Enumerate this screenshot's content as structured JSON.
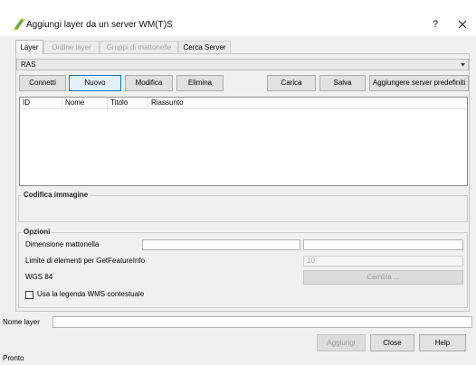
{
  "window": {
    "title": "Aggiungi layer da un server WM(T)S",
    "help_button": "?",
    "app_icon": "qgis-icon",
    "close_icon": "close-icon"
  },
  "tabs": [
    {
      "label": "Layer",
      "active": true,
      "enabled": true
    },
    {
      "label": "Ordine layer",
      "active": false,
      "enabled": false
    },
    {
      "label": "Gruppi di mattonelle",
      "active": false,
      "enabled": false
    },
    {
      "label": "Cerca Server",
      "active": false,
      "enabled": true
    }
  ],
  "connection": {
    "selected": "RAS",
    "dropdown_icon": "chevron-down-icon"
  },
  "connection_buttons": [
    {
      "label": "Connetti",
      "enabled": true,
      "focused": false
    },
    {
      "label": "Nuovo",
      "enabled": true,
      "focused": true
    },
    {
      "label": "Modifica",
      "enabled": true,
      "focused": false
    },
    {
      "label": "Elimina",
      "enabled": true,
      "focused": false
    },
    {
      "label": "Carica",
      "enabled": true,
      "focused": false
    },
    {
      "label": "Salva",
      "enabled": true,
      "focused": false
    },
    {
      "label": "Aggiungere server predefiniti",
      "enabled": true,
      "focused": false
    }
  ],
  "layers_table": {
    "columns": [
      "ID",
      "Nome",
      "Titolo",
      "Riassunto"
    ],
    "rows": []
  },
  "image_encoding": {
    "title": "Codifica immagine",
    "formats": []
  },
  "options": {
    "title": "Opzioni",
    "tile_size": {
      "label": "Dimensione mattonella",
      "width": "",
      "height": ""
    },
    "feature_limit": {
      "label": "Limite di elementi per GetFeatureInfo",
      "value": "10",
      "enabled": false
    },
    "crs": {
      "label": "WGS 84",
      "change_button": "Cambia ...",
      "change_enabled": false
    },
    "contextual_legend": {
      "label": "Usa la legenda WMS contestuale",
      "checked": false
    }
  },
  "layer_name": {
    "label": "Nome layer",
    "value": ""
  },
  "dialog_buttons": [
    {
      "label": "Aggiungi",
      "enabled": false
    },
    {
      "label": "Close",
      "enabled": true
    },
    {
      "label": "Help",
      "enabled": true
    }
  ],
  "status_bar": {
    "text": "Pronto"
  },
  "colors": {
    "focus_accent": "#0078d7",
    "window_bg": "#f0f0f0"
  }
}
